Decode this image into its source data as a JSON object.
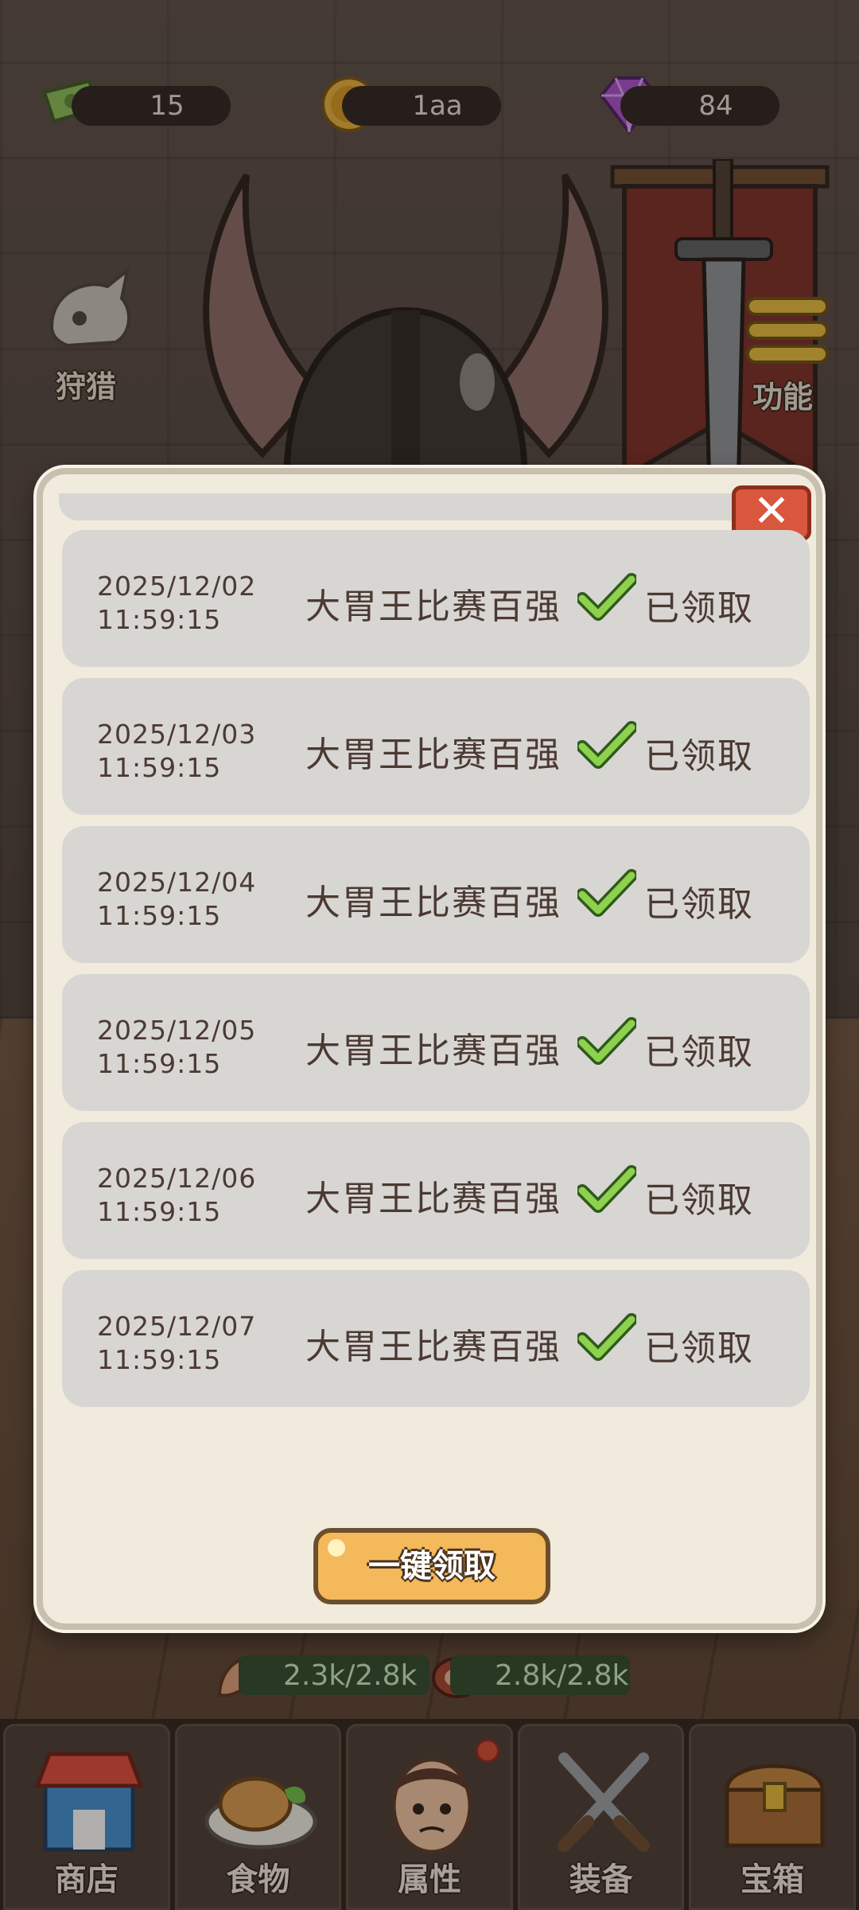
{
  "currencies": [
    {
      "icon": "cash-icon",
      "value": "15"
    },
    {
      "icon": "coin-icon",
      "value": "1aa"
    },
    {
      "icon": "gem-icon",
      "value": "84"
    }
  ],
  "side_buttons": {
    "hunt": "狩猎",
    "functions": "功能"
  },
  "stats": {
    "strength": "2.3k/2.8k",
    "food": "2.8k/2.8k"
  },
  "modal": {
    "close_symbol": "✕",
    "rows": [
      {
        "date": "2025/12/02",
        "time": "11:59:15",
        "title": "大胃王比赛百强",
        "status": "已领取"
      },
      {
        "date": "2025/12/03",
        "time": "11:59:15",
        "title": "大胃王比赛百强",
        "status": "已领取"
      },
      {
        "date": "2025/12/04",
        "time": "11:59:15",
        "title": "大胃王比赛百强",
        "status": "已领取"
      },
      {
        "date": "2025/12/05",
        "time": "11:59:15",
        "title": "大胃王比赛百强",
        "status": "已领取"
      },
      {
        "date": "2025/12/06",
        "time": "11:59:15",
        "title": "大胃王比赛百强",
        "status": "已领取"
      },
      {
        "date": "2025/12/07",
        "time": "11:59:15",
        "title": "大胃王比赛百强",
        "status": "已领取"
      }
    ],
    "claim_all_label": "一键领取"
  },
  "bottom_nav": [
    {
      "label": "商店",
      "icon": "shop-icon"
    },
    {
      "label": "食物",
      "icon": "food-icon"
    },
    {
      "label": "属性",
      "icon": "character-icon",
      "badge": true
    },
    {
      "label": "装备",
      "icon": "equipment-icon"
    },
    {
      "label": "宝箱",
      "icon": "chest-icon"
    }
  ],
  "colors": {
    "accent": "#f4b95a",
    "check": "#8ed14f",
    "close": "#d9573c"
  }
}
